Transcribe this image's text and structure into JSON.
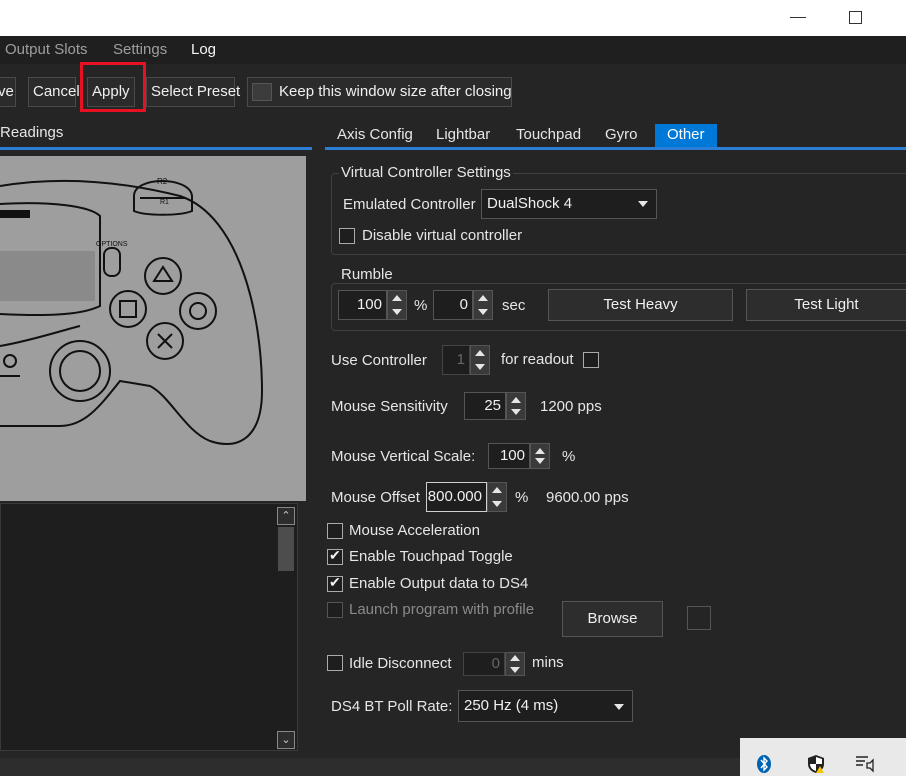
{
  "menu": {
    "items": [
      {
        "label": "Output Slots"
      },
      {
        "label": "Settings"
      },
      {
        "label": "Log"
      }
    ]
  },
  "toolbar": {
    "save_label": "ve",
    "cancel_label": "Cancel",
    "apply_label": "Apply",
    "select_preset_label": "Select Preset",
    "keep_size_label": "Keep this window size after closing"
  },
  "left": {
    "title": "Readings"
  },
  "controller_labels": {
    "r2": "R2",
    "r1": "R1",
    "options": "OPTIONS"
  },
  "tabs": [
    {
      "label": "Axis Config"
    },
    {
      "label": "Lightbar"
    },
    {
      "label": "Touchpad"
    },
    {
      "label": "Gyro"
    },
    {
      "label": "Other"
    }
  ],
  "virtual": {
    "legend": "Virtual Controller Settings",
    "emulated_label": "Emulated Controller",
    "emulated_value": "DualShock 4",
    "disable_label": "Disable virtual controller"
  },
  "rumble": {
    "legend": "Rumble",
    "heavy_value": "100",
    "heavy_unit": "%",
    "light_value": "0",
    "light_unit": "sec",
    "test_heavy_label": "Test Heavy",
    "test_light_label": "Test Light"
  },
  "use_controller": {
    "label": "Use Controller",
    "value": "1",
    "suffix": "for readout"
  },
  "mouse_sens": {
    "label": "Mouse Sensitivity",
    "value": "25",
    "suffix": "1200 pps"
  },
  "mouse_vscale": {
    "label": "Mouse Vertical Scale:",
    "value": "100",
    "suffix": "%"
  },
  "mouse_offset": {
    "label": "Mouse Offset",
    "value": "800.000",
    "unit": "%",
    "suffix": "9600.00 pps"
  },
  "checks": {
    "accel_label": "Mouse Acceleration",
    "touchpad_toggle_label": "Enable Touchpad Toggle",
    "output_data_label": "Enable Output data to DS4",
    "launch_label": "Launch program with profile",
    "browse_label": "Browse"
  },
  "idle": {
    "label": "Idle Disconnect",
    "value": "0",
    "suffix": "mins"
  },
  "poll": {
    "label": "DS4 BT Poll Rate:",
    "value": "250 Hz (4 ms)"
  },
  "colors": {
    "accent": "#0078d7",
    "highlight": "#e81123"
  }
}
